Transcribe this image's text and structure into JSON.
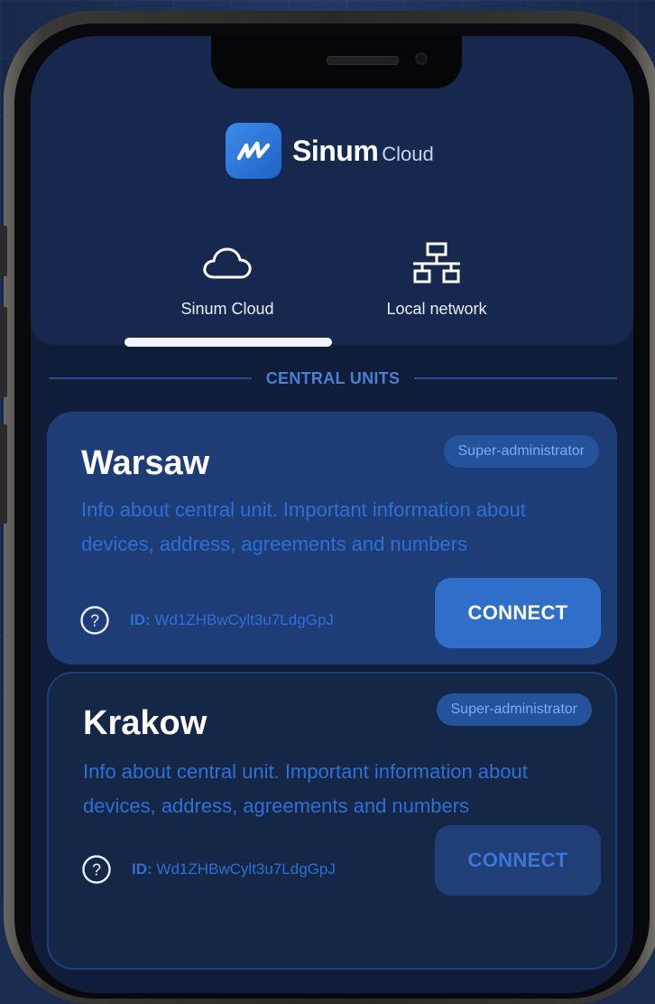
{
  "brand": {
    "name": "Sinum",
    "sub": "Cloud",
    "icon": "sinum-logo-icon"
  },
  "tabs": [
    {
      "label": "Sinum Cloud",
      "icon": "cloud-icon",
      "active": true
    },
    {
      "label": "Local network",
      "icon": "network-icon",
      "active": false
    }
  ],
  "section": {
    "title": "CENTRAL UNITS"
  },
  "cards": [
    {
      "name": "Warsaw",
      "badge": "Super-administrator",
      "info": "Info about central unit. Important information about devices, address, agreements and numbers",
      "id_label": "ID:",
      "id_value": "Wd1ZHBwCylt3u7LdgGpJ",
      "connect_label": "CONNECT"
    },
    {
      "name": "Krakow",
      "badge": "Super-administrator",
      "info": "Info about central unit. Important information about devices, address, agreements and numbers",
      "id_label": "ID:",
      "id_value": "Wd1ZHBwCylt3u7LdgGpJ",
      "connect_label": "CONNECT"
    }
  ],
  "colors": {
    "background": "#1a2c4f",
    "accent": "#2f6ec9",
    "card_active": "#1e3d76",
    "card_inactive": "#152746",
    "info_text": "#2f6fd4"
  }
}
